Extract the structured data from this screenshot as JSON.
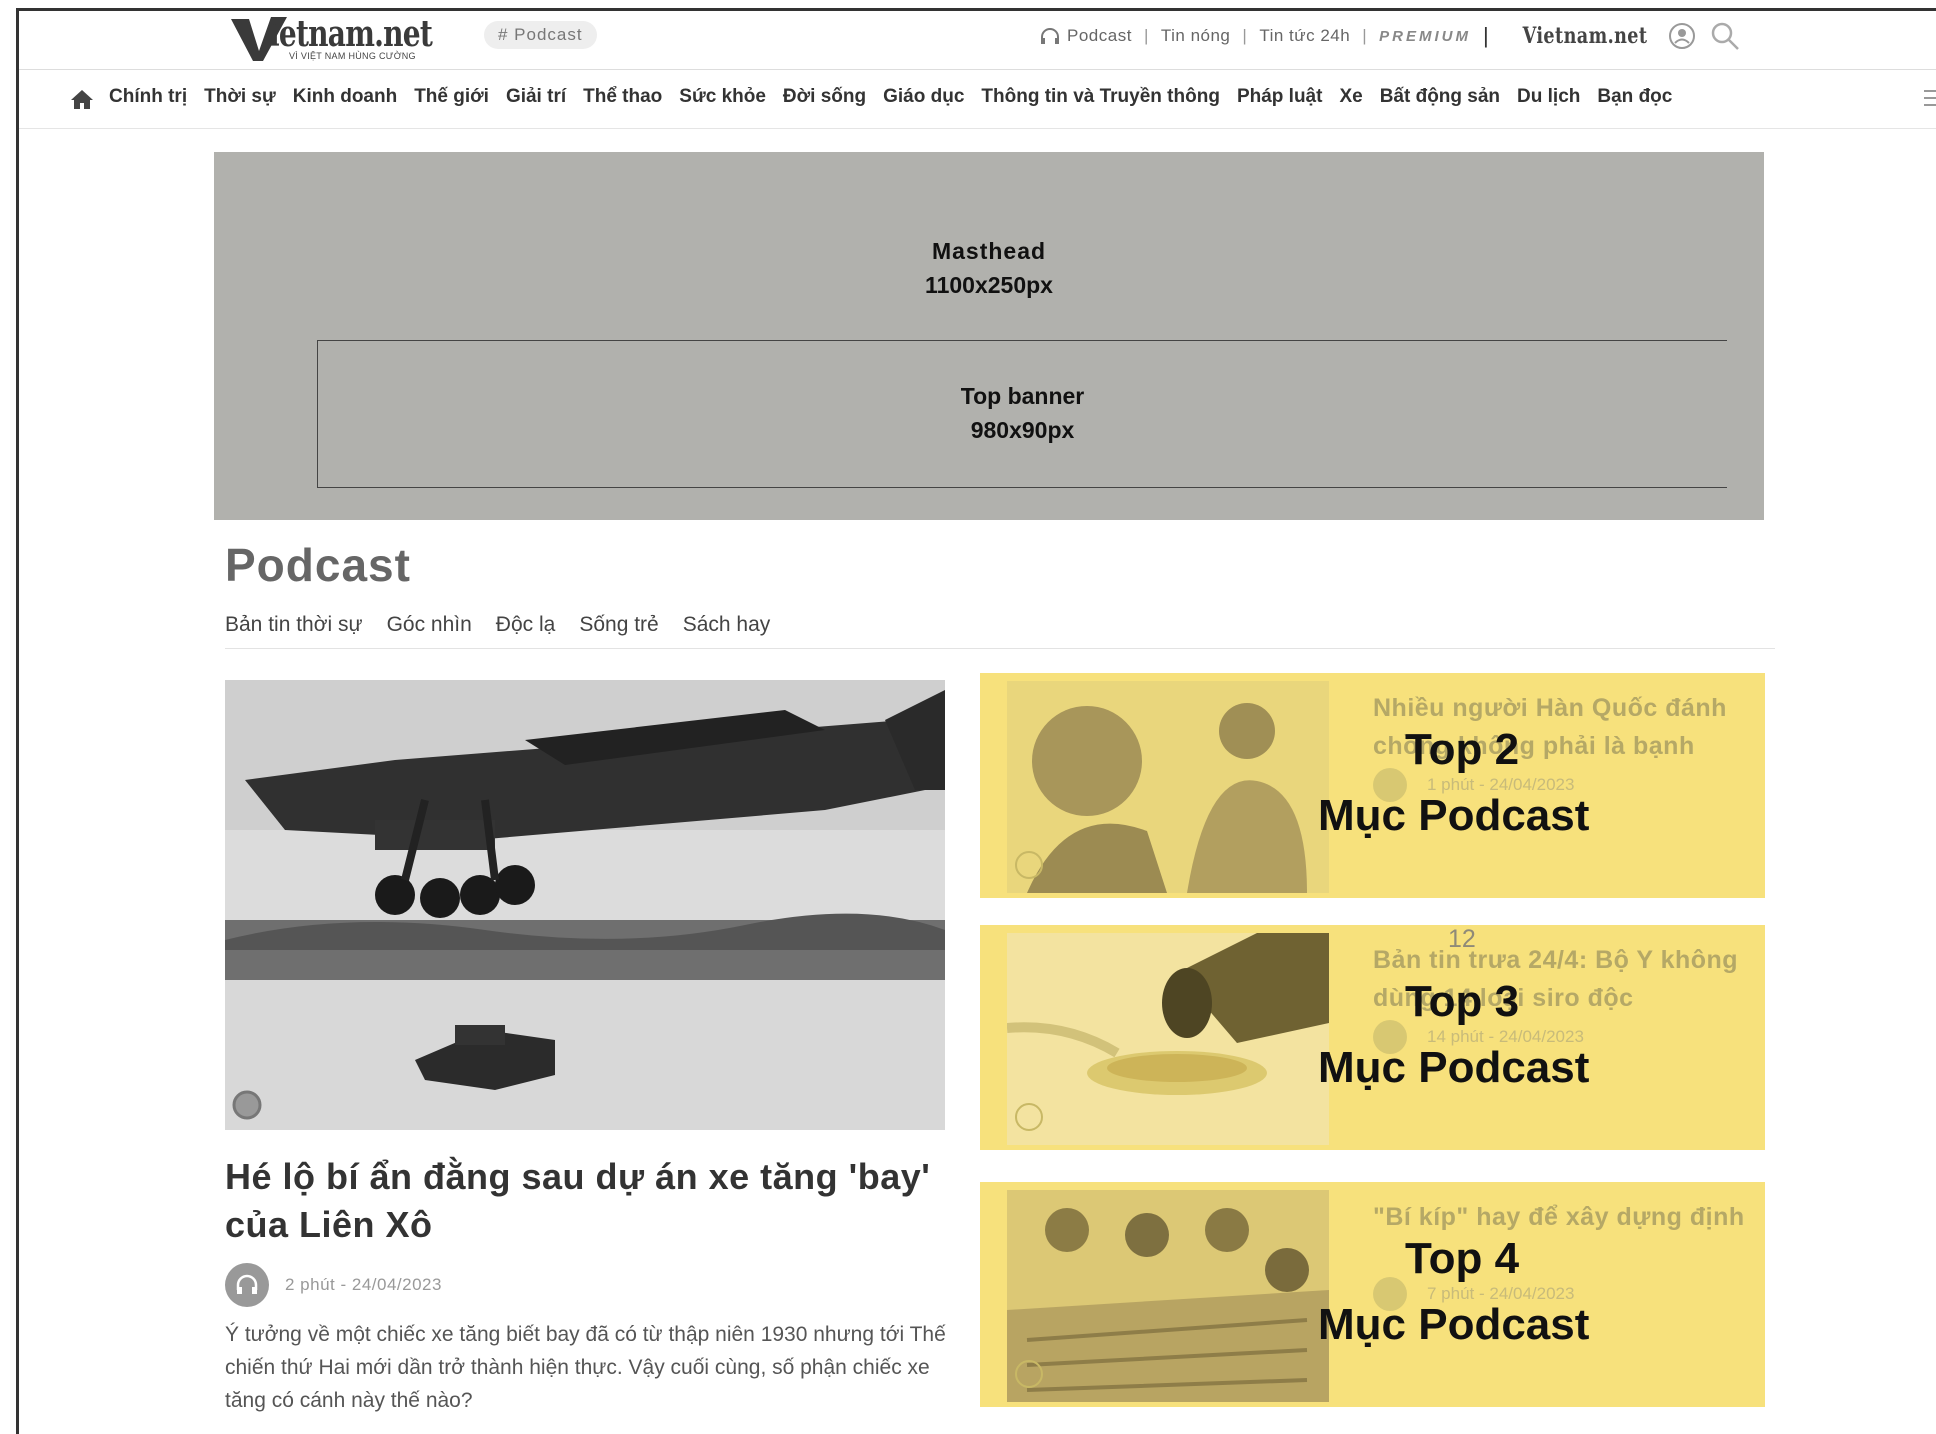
{
  "header": {
    "logo_text": "ietnam.net",
    "logo_tagline": "VÌ VIỆT NAM HÙNG CƯỜNG",
    "tag_pill": "# Podcast",
    "links": [
      "Podcast",
      "Tin nóng",
      "Tin tức 24h"
    ],
    "premium": "PREMIUM",
    "mini_logo": "Vietnam.net"
  },
  "nav": {
    "items": [
      "Chính trị",
      "Thời sự",
      "Kinh doanh",
      "Thế giới",
      "Giải trí",
      "Thể thao",
      "Sức khỏe",
      "Đời sống",
      "Giáo dục",
      "Thông tin và Truyền thông",
      "Pháp luật",
      "Xe",
      "Bất động sản",
      "Du lịch",
      "Bạn đọc"
    ]
  },
  "masthead": {
    "label": "Masthead",
    "size": "1100x250px",
    "banner_label": "Top banner",
    "banner_size": "980x90px"
  },
  "section": {
    "title": "Podcast",
    "tabs": [
      "Bản tin thời sự",
      "Góc nhìn",
      "Độc lạ",
      "Sống trẻ",
      "Sách hay"
    ]
  },
  "main_article": {
    "title": "Hé lộ bí ẩn đằng sau dự án xe tăng 'bay' của Liên Xô",
    "meta": "2 phút - 24/04/2023",
    "description": "Ý tưởng về một chiếc xe tăng biết bay đã có từ thập niên 1930 nhưng tới Thế chiến thứ Hai mới dần trở thành hiện thực. Vậy cuối cùng, số phận chiếc xe tăng có cánh này thế nào?"
  },
  "cards": [
    {
      "title": "Nhiều người Hàn Quốc đánh chồng không phải là bạnh",
      "meta": "1 phút - 24/04/2023",
      "top": "Top 2",
      "category": "Mục Podcast"
    },
    {
      "title": "Bản tin trưa 24/4: Bộ Y không dùng 14 loại siro độc",
      "meta": "14 phút - 24/04/2023",
      "top": "Top 3",
      "category": "Mục Podcast"
    },
    {
      "title": "\"Bí kíp\" hay để xây dựng định",
      "meta": "7 phút - 24/04/2023",
      "top": "Top 4",
      "category": "Mục Podcast"
    }
  ],
  "page_number": "12"
}
